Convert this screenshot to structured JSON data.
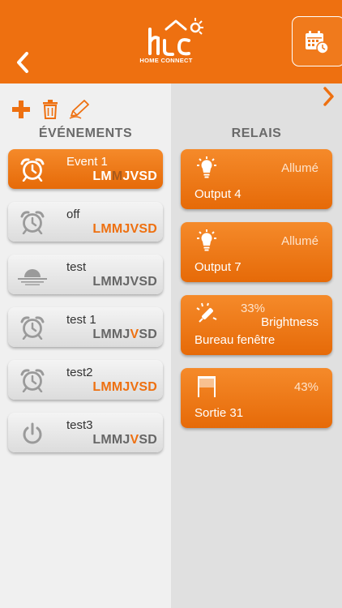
{
  "app": {
    "logo_text": "HOME CONNECT"
  },
  "header": {
    "back_icon": "chevron-left-icon",
    "calendar_icon": "calendar-clock-icon"
  },
  "toolbar": {
    "add_icon": "plus-icon",
    "delete_icon": "trash-icon",
    "edit_icon": "pencil-icon"
  },
  "columns": {
    "events_title": "ÉVÉNEMENTS",
    "relays_title": "RELAIS"
  },
  "colors": {
    "accent": "#ee7010",
    "muted": "#666666"
  },
  "events": [
    {
      "name": "Event 1",
      "icon": "alarm-clock-icon",
      "active": true,
      "days": [
        {
          "l": "L",
          "on": true
        },
        {
          "l": "M",
          "on": true
        },
        {
          "l": "M",
          "on": false
        },
        {
          "l": "J",
          "on": true
        },
        {
          "l": "V",
          "on": true
        },
        {
          "l": "S",
          "on": true
        },
        {
          "l": "D",
          "on": true
        }
      ]
    },
    {
      "name": "off",
      "icon": "alarm-clock-icon",
      "active": false,
      "days": [
        {
          "l": "L",
          "on": true
        },
        {
          "l": "M",
          "on": true
        },
        {
          "l": "M",
          "on": true
        },
        {
          "l": "J",
          "on": true
        },
        {
          "l": "V",
          "on": true
        },
        {
          "l": "S",
          "on": true
        },
        {
          "l": "D",
          "on": true
        }
      ]
    },
    {
      "name": "test",
      "icon": "sunset-icon",
      "active": false,
      "days": [
        {
          "l": "L",
          "on": false
        },
        {
          "l": "M",
          "on": false
        },
        {
          "l": "M",
          "on": false
        },
        {
          "l": "J",
          "on": false
        },
        {
          "l": "V",
          "on": false
        },
        {
          "l": "S",
          "on": false
        },
        {
          "l": "D",
          "on": false
        }
      ]
    },
    {
      "name": "test 1",
      "icon": "alarm-clock-icon",
      "active": false,
      "days": [
        {
          "l": "L",
          "on": false
        },
        {
          "l": "M",
          "on": false
        },
        {
          "l": "M",
          "on": false
        },
        {
          "l": "J",
          "on": false
        },
        {
          "l": "V",
          "on": true
        },
        {
          "l": "S",
          "on": false
        },
        {
          "l": "D",
          "on": false
        }
      ]
    },
    {
      "name": "test2",
      "icon": "alarm-clock-icon",
      "active": false,
      "days": [
        {
          "l": "L",
          "on": true
        },
        {
          "l": "M",
          "on": true
        },
        {
          "l": "M",
          "on": true
        },
        {
          "l": "J",
          "on": true
        },
        {
          "l": "V",
          "on": true
        },
        {
          "l": "S",
          "on": true
        },
        {
          "l": "D",
          "on": true
        }
      ]
    },
    {
      "name": "test3",
      "icon": "power-icon",
      "active": false,
      "days": [
        {
          "l": "L",
          "on": false
        },
        {
          "l": "M",
          "on": false
        },
        {
          "l": "M",
          "on": false
        },
        {
          "l": "J",
          "on": false
        },
        {
          "l": "V",
          "on": true
        },
        {
          "l": "S",
          "on": false
        },
        {
          "l": "D",
          "on": false
        }
      ]
    }
  ],
  "relays": [
    {
      "name": "Output  4",
      "status": "Allumé",
      "icon": "lightbulb-icon"
    },
    {
      "name": "Output 7",
      "status": "Allumé",
      "icon": "lightbulb-icon"
    },
    {
      "name": "Bureau fenêtre",
      "percent": "33%",
      "status": "Brightness",
      "icon": "dimmer-light-icon"
    },
    {
      "name": "Sortie 31",
      "status": "43%",
      "icon": "shutter-icon"
    }
  ],
  "nav": {
    "next_icon": "chevron-right-icon"
  }
}
